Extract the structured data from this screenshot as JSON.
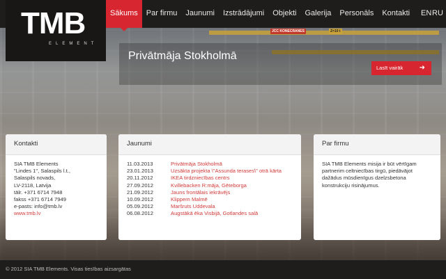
{
  "logo": {
    "text": "TMB",
    "subtitle": "ELEMENT"
  },
  "nav": {
    "items": [
      "Sākums",
      "Par firmu",
      "Jaunumi",
      "Izstrādājumi",
      "Objekti",
      "Galerija",
      "Personāls",
      "Kontakti"
    ],
    "active_index": 0,
    "languages": [
      "EN",
      "RU"
    ]
  },
  "hero": {
    "slide_title": "Privātmāja Stokholmā",
    "read_more_label": "Lasīt vairāk",
    "arrow_icon": "arrow-right-icon",
    "crane_labels": [
      "JCC KONECRANES",
      "Z=10 t"
    ]
  },
  "contacts": {
    "heading": "Kontakti",
    "lines": [
      "SIA TMB Elements",
      "\"Lindes 1\", Salaspils l.t.,",
      "Salaspils novads,",
      "LV-2118, Latvija",
      "tālr.  +371 6714 7948",
      "fakss  +371 6714 7949",
      "e-pasts: info@tmb.lv"
    ],
    "website": "www.tmb.lv"
  },
  "news": {
    "heading": "Jaunumi",
    "items": [
      {
        "date": "11.03.2013",
        "title": "Privātmāja Stokholmā"
      },
      {
        "date": "23.01.2013",
        "title": "Uzsākta projekta \\\"Assunda terases\\\" otrā kārta"
      },
      {
        "date": "20.11.2012",
        "title": "IKEA tirdzniecības centrs"
      },
      {
        "date": "27.09.2012",
        "title": "Kvillebacken R:māja, Gēteborga"
      },
      {
        "date": "21.09.2012",
        "title": "Jauns frontālais iekrāvējs"
      },
      {
        "date": "10.09.2012",
        "title": "Klippern Malmē"
      },
      {
        "date": "05.09.2012",
        "title": "Maršruts Uddevala"
      },
      {
        "date": "06.08.2012",
        "title": "Augstākā ēka Visbijā, Gotlandes salā"
      }
    ]
  },
  "about": {
    "heading": "Par firmu",
    "text": "SIA TMB Elements misija ir būt vērtīgam partnerim celtniecības tirgū, piedāvājot dažādus mūsdienīgus dzelzsbetona konstrukciju risinājumus."
  },
  "footer": {
    "copyright": "© 2012 SIA TMB Elements. Visas tiesības aizsargātas"
  },
  "colors": {
    "accent": "#d7262f",
    "header_bg": "#1f1d1c",
    "link": "#d23a3a"
  }
}
